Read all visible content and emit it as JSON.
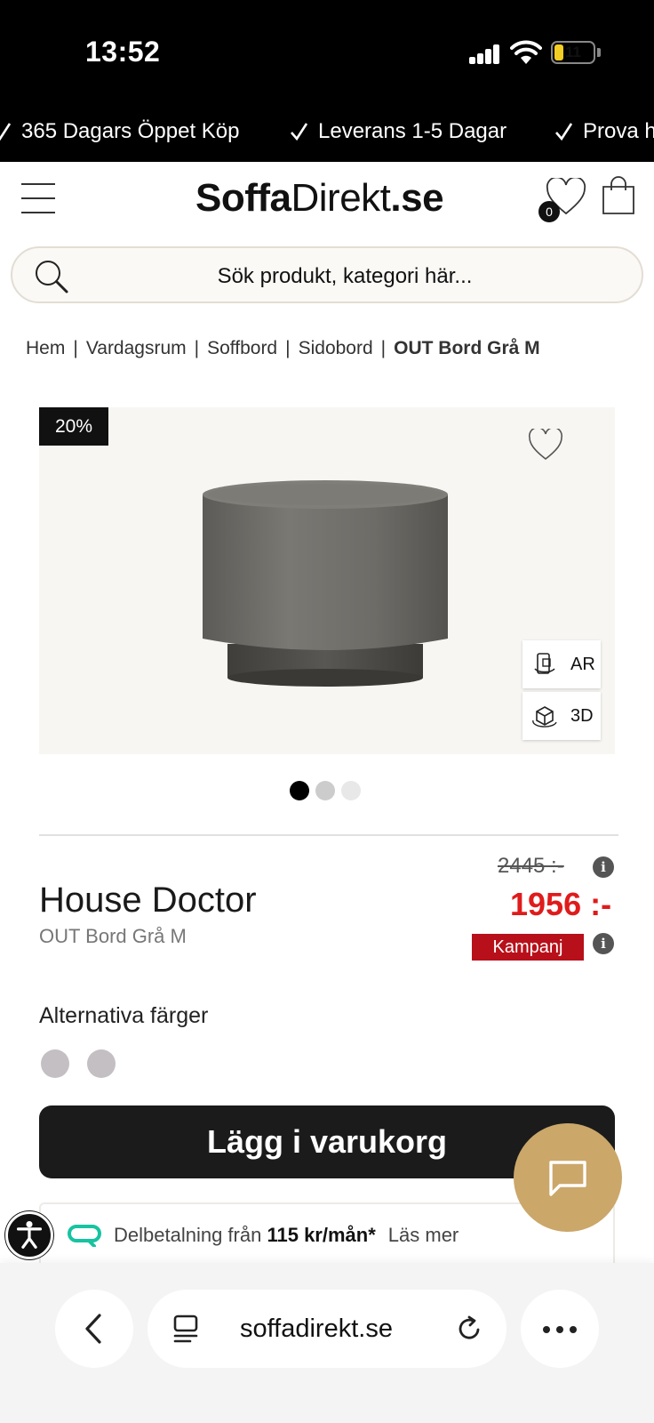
{
  "status_bar": {
    "time": "13:52",
    "battery": "11"
  },
  "usp": [
    "365 Dagars Öppet Köp",
    "Leverans 1-5 Dagar",
    "Prova h"
  ],
  "header": {
    "logo_bold": "Soffa",
    "logo_thin": "Direkt",
    "logo_tld": ".se",
    "wishlist_count": "0"
  },
  "search": {
    "placeholder": "Sök produkt, kategori här..."
  },
  "breadcrumb": [
    "Hem",
    "Vardagsrum",
    "Soffbord",
    "Sidobord",
    "OUT Bord Grå M"
  ],
  "product": {
    "discount": "20%",
    "brand": "House Doctor",
    "name": "OUT Bord Grå M",
    "old_price": "2445 :-",
    "price": "1956 :-",
    "campaign_label": "Kampanj",
    "ar_label": "AR",
    "threed_label": "3D",
    "image_count": 3,
    "active_image": 1
  },
  "alt_colors": {
    "title": "Alternativa färger",
    "swatches": [
      "#c4bfc3",
      "#c4bfc3"
    ]
  },
  "add_to_cart": "Lägg i varukorg",
  "installment": {
    "prefix": "Delbetalning från",
    "amount": "115 kr/mån*",
    "link": "Läs mer"
  },
  "browser": {
    "url": "soffadirekt.se"
  },
  "colors": {
    "price_red": "#e01b1b",
    "campaign_red": "#b8101a",
    "chat_gold": "#cba76a",
    "installment_green": "#17c3a1"
  }
}
